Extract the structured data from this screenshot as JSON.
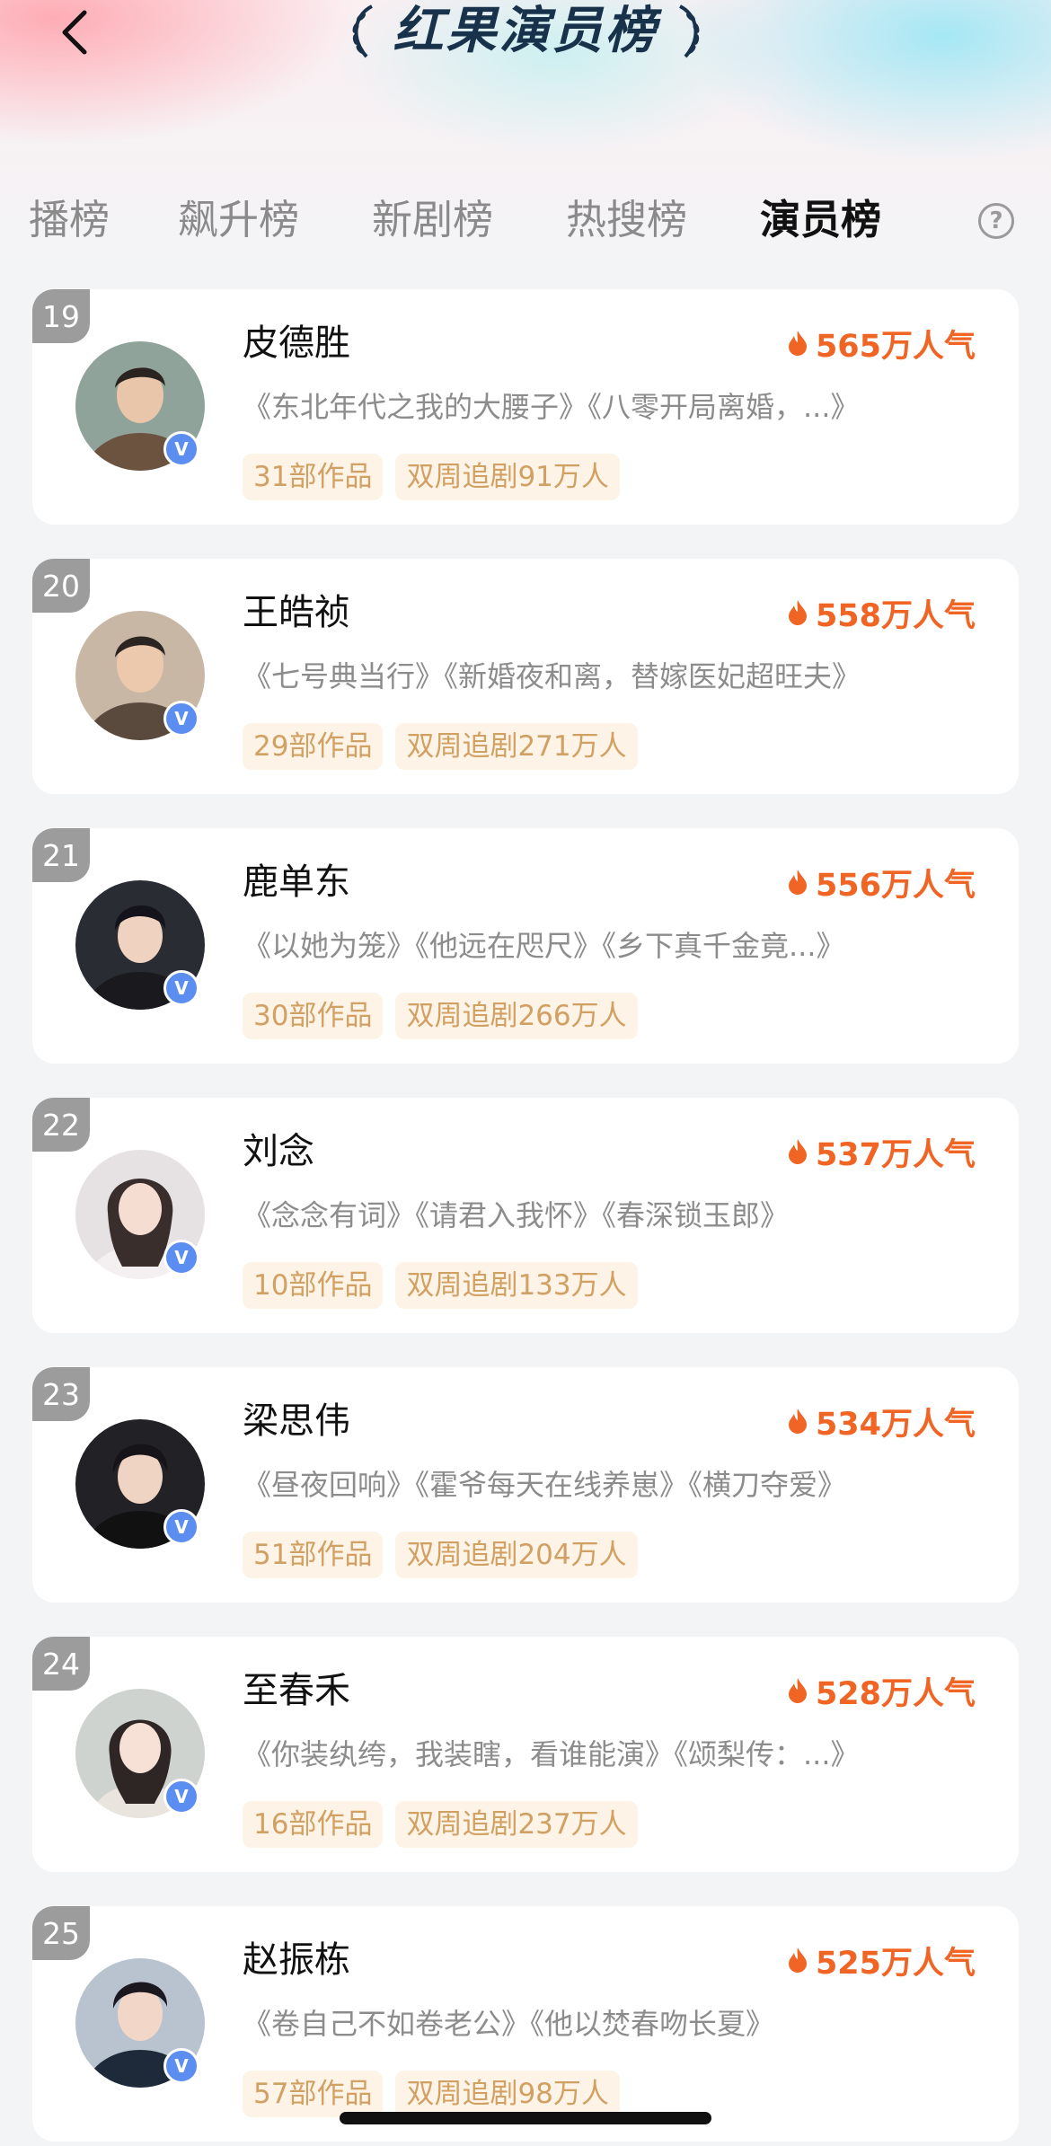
{
  "header": {
    "title": "红果演员榜"
  },
  "tabs": [
    {
      "label": "播榜",
      "active": false
    },
    {
      "label": "飙升榜",
      "active": false
    },
    {
      "label": "新剧榜",
      "active": false
    },
    {
      "label": "热搜榜",
      "active": false
    },
    {
      "label": "演员榜",
      "active": true
    }
  ],
  "colors": {
    "accent": "#f06424",
    "tag_bg": "#fdf3e6",
    "tag_text": "#d1a063",
    "verified_badge": "#5b8ef0",
    "rank_badge": "#9c9c9c"
  },
  "actors": [
    {
      "rank": "19",
      "name": "皮德胜",
      "popularity": "565万人气",
      "works": "《东北年代之我的大腰子》《八零开局离婚，...》",
      "count": "31部作品",
      "followers": "双周追剧91万人"
    },
    {
      "rank": "20",
      "name": "王皓祯",
      "popularity": "558万人气",
      "works": "《七号典当行》《新婚夜和离，替嫁医妃超旺夫》",
      "count": "29部作品",
      "followers": "双周追剧271万人"
    },
    {
      "rank": "21",
      "name": "鹿单东",
      "popularity": "556万人气",
      "works": "《以她为笼》《他远在咫尺》《乡下真千金竟...》",
      "count": "30部作品",
      "followers": "双周追剧266万人"
    },
    {
      "rank": "22",
      "name": "刘念",
      "popularity": "537万人气",
      "works": "《念念有词》《请君入我怀》《春深锁玉郎》",
      "count": "10部作品",
      "followers": "双周追剧133万人"
    },
    {
      "rank": "23",
      "name": "梁思伟",
      "popularity": "534万人气",
      "works": "《昼夜回响》《霍爷每天在线养崽》《横刀夺爱》",
      "count": "51部作品",
      "followers": "双周追剧204万人"
    },
    {
      "rank": "24",
      "name": "至春禾",
      "popularity": "528万人气",
      "works": "《你装纨绔，我装瞎，看谁能演》《颂梨传：...》",
      "count": "16部作品",
      "followers": "双周追剧237万人"
    },
    {
      "rank": "25",
      "name": "赵振栋",
      "popularity": "525万人气",
      "works": "《卷自己不如卷老公》《他以焚春吻长夏》",
      "count": "57部作品",
      "followers": "双周追剧98万人"
    }
  ],
  "icons": {
    "back": "chevron-left-icon",
    "help": "question-circle-icon",
    "laurel": "laurel-icon",
    "flame": "flame-icon",
    "verified": "verified-badge-icon"
  },
  "verified_glyph": "V",
  "help_glyph": "?"
}
